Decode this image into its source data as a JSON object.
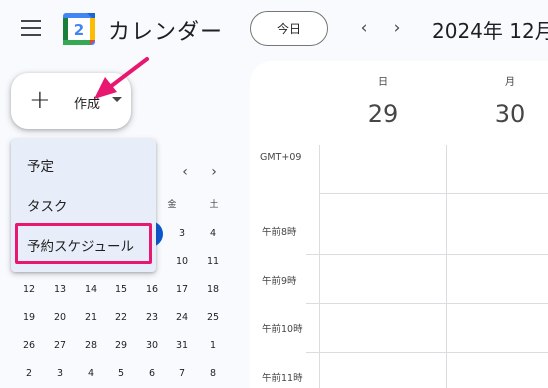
{
  "header": {
    "logo_day": "2",
    "app_title": "カレンダー",
    "today_label": "今日",
    "date_range": "2024年 12月"
  },
  "create": {
    "label": "作成"
  },
  "dropdown": {
    "items": [
      "予定",
      "タスク",
      "予約スケジュール"
    ],
    "highlight_color": "#e8176f"
  },
  "mini_calendar": {
    "dow_partial": [
      "水",
      "木",
      "金",
      "土"
    ],
    "today_color": "#0b57d0",
    "rows": [
      [
        "3",
        "4"
      ],
      [
        "10",
        "11"
      ],
      [
        "12",
        "13",
        "14",
        "15",
        "16",
        "17",
        "18"
      ],
      [
        "19",
        "20",
        "21",
        "22",
        "23",
        "24",
        "25"
      ],
      [
        "26",
        "27",
        "28",
        "29",
        "30",
        "31",
        "1"
      ],
      [
        "2",
        "3",
        "4",
        "5",
        "6",
        "7",
        "8"
      ]
    ]
  },
  "week": {
    "days": [
      {
        "name": "日",
        "num": "29"
      },
      {
        "name": "月",
        "num": "30"
      }
    ],
    "timezone": "GMT+09",
    "hours": [
      "午前8時",
      "午前9時",
      "午前10時",
      "午前11時"
    ]
  },
  "colors": {
    "accent_blue": "#0b57d0",
    "annotation_pink": "#e8176f"
  }
}
